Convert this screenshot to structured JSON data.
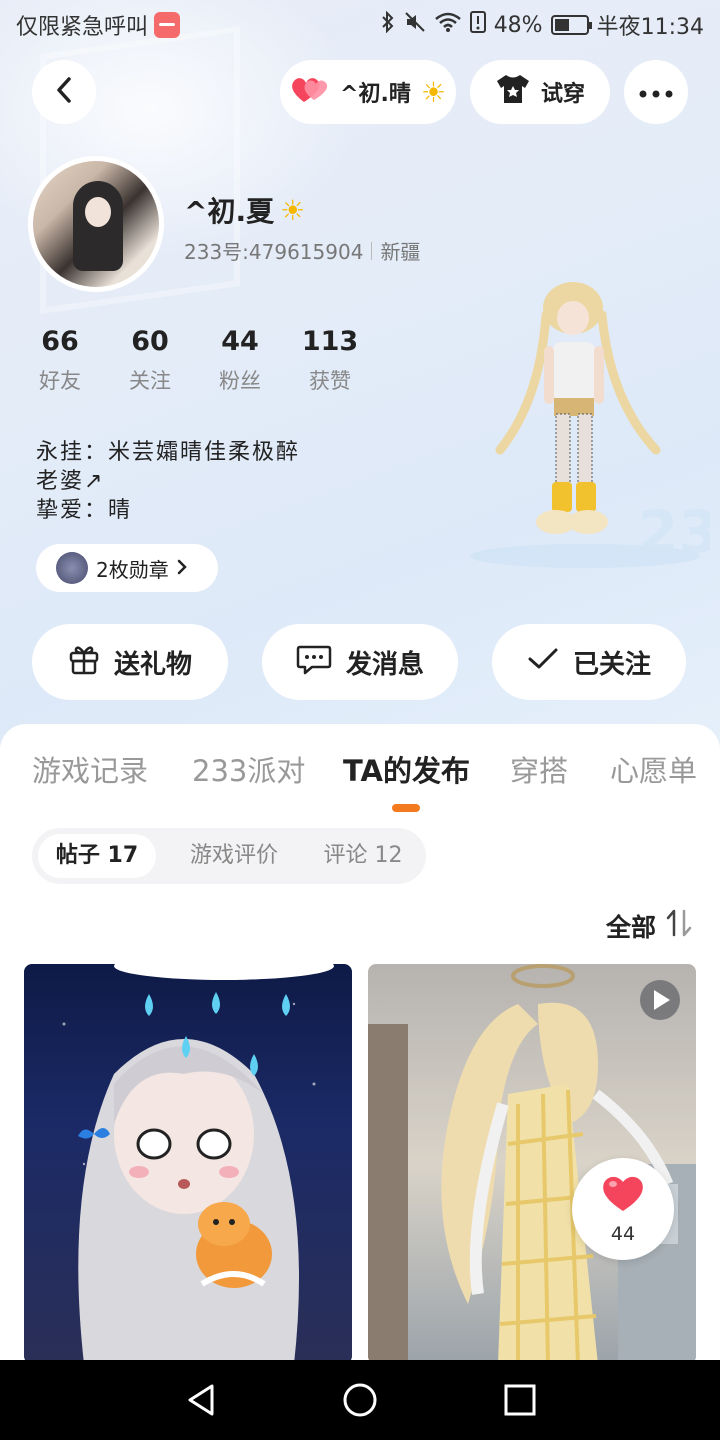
{
  "status_bar": {
    "carrier_text": "仅限紧急呼叫",
    "battery": "48%",
    "time": "半夜11:34"
  },
  "header": {
    "back_icon": "chevron-left-icon",
    "companion_name": "^初.晴",
    "tryon_label": "试穿",
    "more_icon": "more-horizontal-icon"
  },
  "profile": {
    "name": "^初.夏",
    "id_text": "233号:479615904",
    "location": "新疆",
    "stats": [
      {
        "value": "66",
        "label": "好友"
      },
      {
        "value": "60",
        "label": "关注"
      },
      {
        "value": "44",
        "label": "粉丝"
      },
      {
        "value": "113",
        "label": "获赞"
      }
    ],
    "bio_lines": [
      "永挂：米芸孀晴佳柔极醉",
      "老婆↗",
      "挚爱：晴"
    ],
    "medal_label": "2枚勋章"
  },
  "actions": {
    "gift": "送礼物",
    "message": "发消息",
    "followed": "已关注"
  },
  "tabs": [
    "游戏记录",
    "233派对",
    "TA的发布",
    "穿搭",
    "心愿单"
  ],
  "active_tab": "TA的发布",
  "segments": [
    "帖子 17",
    "游戏评价",
    "评论 12"
  ],
  "sort_label": "全部",
  "posts": {
    "like_count": "44"
  },
  "colors": {
    "accent": "#f47a1f",
    "heart": "#f5455c",
    "sun": "#f5b800"
  }
}
